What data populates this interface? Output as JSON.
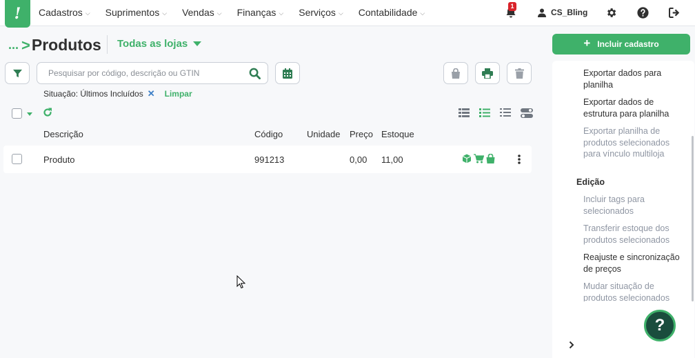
{
  "app": {
    "logo_glyph": "!",
    "brand_color": "#3fb16a"
  },
  "nav": {
    "menu": [
      {
        "label": "Cadastros"
      },
      {
        "label": "Suprimentos"
      },
      {
        "label": "Vendas"
      },
      {
        "label": "Finanças"
      },
      {
        "label": "Serviços"
      },
      {
        "label": "Contabilidade"
      }
    ],
    "notification_count": "1",
    "user_name": "CS_Bling"
  },
  "header": {
    "breadcrumb_ellipsis": "...",
    "breadcrumb_separator": ">",
    "title": "Produtos",
    "store_select": "Todas as lojas",
    "include_button": "Incluir cadastro"
  },
  "search": {
    "placeholder": "Pesquisar por código, descrição ou GTIN",
    "value": ""
  },
  "filter": {
    "label": "Situação: Últimos Incluídos",
    "remove_glyph": "✕",
    "clear_label": "Limpar"
  },
  "table": {
    "columns": [
      "Descrição",
      "Código",
      "Unidade",
      "Preço",
      "Estoque"
    ],
    "rows": [
      {
        "descricao": "Produto",
        "codigo": "991213",
        "unidade": "",
        "preco": "0,00",
        "estoque": "11,00"
      }
    ]
  },
  "side_panel": {
    "items_top": [
      {
        "label": "Exportar dados para planilha",
        "enabled": true
      },
      {
        "label": "Exportar dados de estrutura para planilha",
        "enabled": true
      },
      {
        "label": "Exportar planilha de produtos selecionados para vínculo multiloja",
        "enabled": false
      }
    ],
    "section_title": "Edição",
    "items_edit": [
      {
        "label": "Incluir tags para selecionados",
        "enabled": false
      },
      {
        "label": "Transferir estoque dos produtos selecionados",
        "enabled": false
      },
      {
        "label": "Reajuste e sincronização de preços",
        "enabled": true
      },
      {
        "label": "Mudar situação de produtos selecionados",
        "enabled": false
      }
    ]
  },
  "help_button": "?"
}
